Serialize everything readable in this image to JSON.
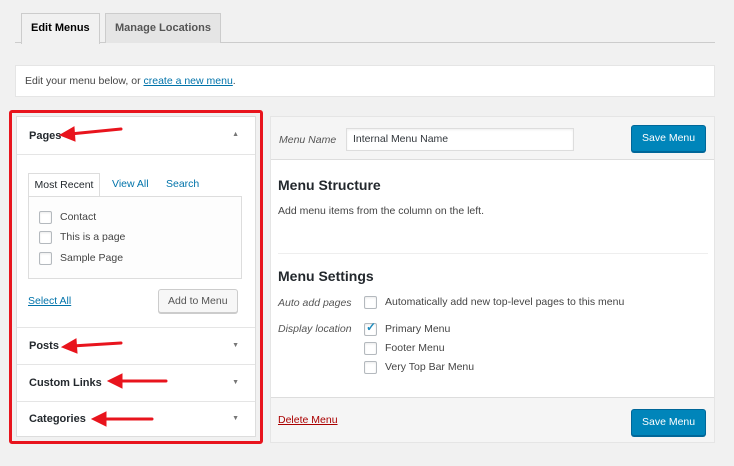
{
  "tabs": {
    "edit_menus": "Edit Menus",
    "manage_locations": "Manage Locations"
  },
  "notice": {
    "text": "Edit your menu below, or ",
    "link": "create a new menu",
    "suffix": "."
  },
  "left": {
    "pages": {
      "title": "Pages",
      "tabs": {
        "most_recent": "Most Recent",
        "view_all": "View All",
        "search": "Search"
      },
      "items": [
        "Contact",
        "This is a page",
        "Sample Page"
      ],
      "select_all": "Select All",
      "add_button": "Add to Menu"
    },
    "posts": {
      "title": "Posts"
    },
    "custom_links": {
      "title": "Custom Links"
    },
    "categories": {
      "title": "Categories"
    }
  },
  "right": {
    "menu_name_label": "Menu Name",
    "menu_name_value": "Internal Menu Name",
    "save_label": "Save Menu",
    "structure_title": "Menu Structure",
    "structure_hint": "Add menu items from the column on the left.",
    "settings_title": "Menu Settings",
    "auto_add_label": "Auto add pages",
    "auto_add_text": "Automatically add new top-level pages to this menu",
    "display_location_label": "Display location",
    "locations": [
      {
        "label": "Primary Menu",
        "checked": true
      },
      {
        "label": "Footer Menu",
        "checked": false
      },
      {
        "label": "Very Top Bar Menu",
        "checked": false
      }
    ],
    "delete_label": "Delete Menu"
  },
  "colors": {
    "accent": "#0085ba",
    "annotation_red": "#e8141d",
    "link": "#0073aa",
    "danger": "#a00"
  },
  "icons": {
    "collapse": "triangle-up-icon",
    "expand": "triangle-down-icon",
    "check": "checkmark-icon",
    "annotation": "red-arrow-icon"
  }
}
